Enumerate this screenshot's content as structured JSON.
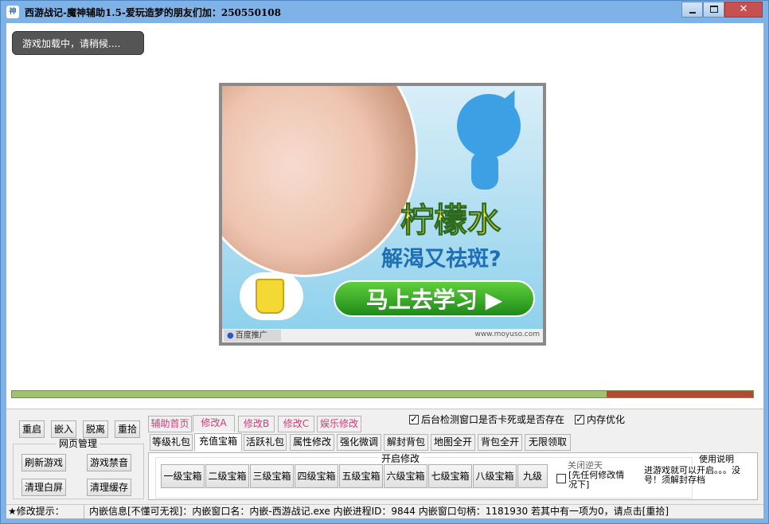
{
  "window": {
    "icon_text": "神",
    "title": "西游战记-魔神辅助1.5-爱玩造梦的朋友们加：250550108",
    "controls": {
      "minimize": "",
      "maximize": "",
      "close": "✕"
    }
  },
  "toast": {
    "text": "游戏加载中，请稍候...."
  },
  "ad": {
    "headline": "柠檬水",
    "subline": "解渴又祛斑?",
    "cta": "马上去学习 ▶",
    "badge_icon": "paw-icon",
    "badge": "百度推广",
    "url": "www.moyuso.com"
  },
  "progress": {
    "value": 0.802
  },
  "left_buttons": {
    "restart": "重启",
    "embed": "嵌入",
    "detach": "脱离",
    "repick": "重拾"
  },
  "web_mgmt": {
    "title": "网页管理",
    "refresh": "刷新游戏",
    "mute": "游戏禁音",
    "clear_screen": "清理白屏",
    "clear_cache": "清理缓存"
  },
  "top_tabs": [
    "辅助首页",
    "修改A",
    "修改B",
    "修改C",
    "娱乐修改"
  ],
  "checkboxes": {
    "bg_detect": "后台检测窗口是否卡死或是否存在",
    "mem_opt": "内存优化"
  },
  "sub_tabs": [
    "等级礼包",
    "充值宝箱",
    "活跃礼包",
    "属性修改",
    "强化微调",
    "解封背包",
    "地图全开",
    "背包全开",
    "无限领取"
  ],
  "open_mod": {
    "title": "开启修改",
    "items": [
      "一级宝箱",
      "二级宝箱",
      "三级宝箱",
      "四级宝箱",
      "五级宝箱",
      "六级宝箱",
      "七级宝箱",
      "八级宝箱",
      "九级"
    ]
  },
  "option": {
    "title": "关闭逆天",
    "label": "[先任何修改情况下]"
  },
  "usage": {
    "title": "使用说明",
    "text": "进游戏就可以开启。。。没号！须解封存档"
  },
  "status": {
    "hint": "★修改提示：",
    "info": "内嵌信息[不懂可无视]：内嵌窗口名：内嵌-西游战记.exe 内嵌进程ID：9844 内嵌窗口句柄：1181930 若其中有一项为0，请点击[重拾]"
  }
}
